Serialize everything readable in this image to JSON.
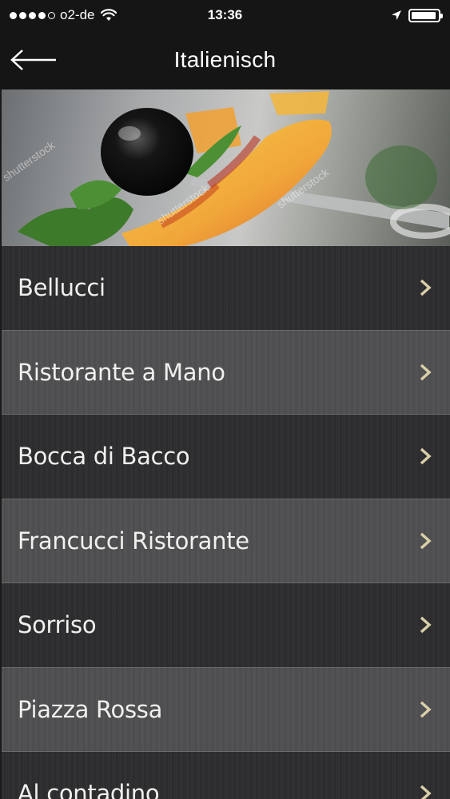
{
  "status_bar": {
    "carrier": "o2-de",
    "time": "13:36",
    "signal_bars_filled": 4,
    "signal_bars_total": 5,
    "battery_level": 0.95
  },
  "nav": {
    "title": "Italienisch",
    "back_icon": "arrow-left-icon"
  },
  "hero": {
    "watermark": "shutterstock",
    "image": "pasta-with-olive"
  },
  "restaurants": [
    {
      "name": "Bellucci"
    },
    {
      "name": "Ristorante a Mano"
    },
    {
      "name": "Bocca di Bacco"
    },
    {
      "name": "Francucci Ristorante"
    },
    {
      "name": "Sorriso"
    },
    {
      "name": "Piazza Rossa"
    },
    {
      "name": "Al contadino"
    }
  ],
  "colors": {
    "chevron": "#d8cfa8",
    "nav_bg": "#151515"
  }
}
